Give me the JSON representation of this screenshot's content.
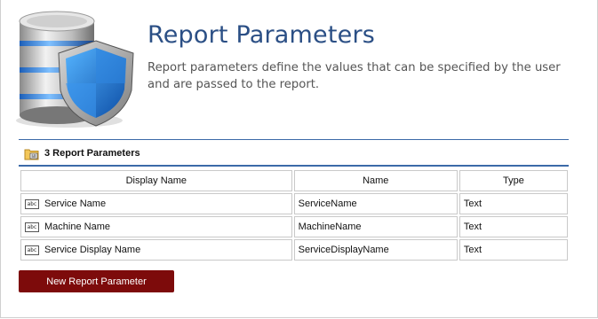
{
  "header": {
    "title": "Report Parameters",
    "description": "Report parameters define the values that can be specified by the user and are passed to the report."
  },
  "section": {
    "title": "3 Report Parameters"
  },
  "table": {
    "columns": [
      "Display Name",
      "Name",
      "Type"
    ],
    "rows": [
      {
        "display_name": "Service Name",
        "name": "ServiceName",
        "type": "Text",
        "icon": "abc-text-icon"
      },
      {
        "display_name": "Machine Name",
        "name": "MachineName",
        "type": "Text",
        "icon": "abc-text-icon"
      },
      {
        "display_name": "Service Display Name",
        "name": "ServiceDisplayName",
        "type": "Text",
        "icon": "abc-text-icon"
      }
    ]
  },
  "actions": {
    "new_button_label": "New Report Parameter"
  },
  "colors": {
    "title": "#2b4f85",
    "rule": "#3b6aa8",
    "button": "#7d0b0b"
  }
}
